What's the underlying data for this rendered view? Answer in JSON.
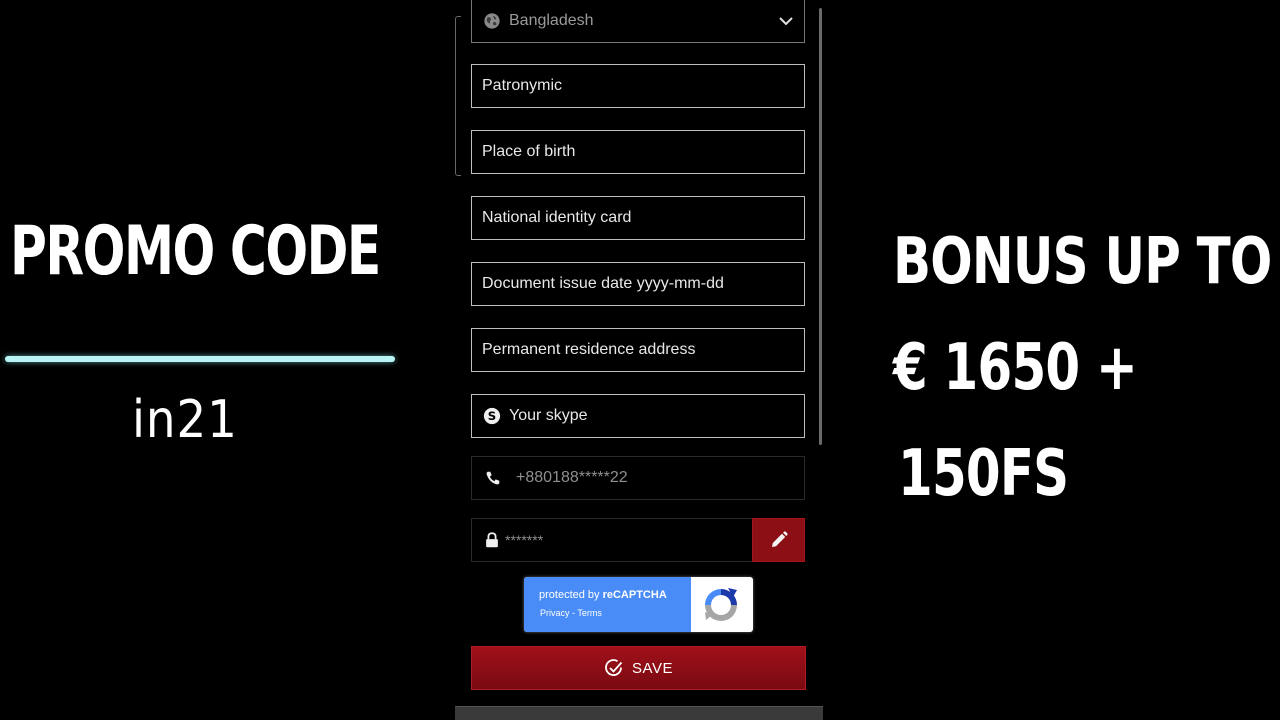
{
  "promo": {
    "title": "PROMO CODE",
    "code": "in21",
    "underline_color": "#b9f3f5"
  },
  "bonus": {
    "line1": "BONUS UP TO",
    "line2": "€ 1650 +",
    "line3": "150FS"
  },
  "form": {
    "country": {
      "value": "Bangladesh",
      "icon": "globe-icon",
      "toggle_icon": "chevron-down-icon"
    },
    "patronymic": {
      "placeholder": "Patronymic"
    },
    "place_of_birth": {
      "placeholder": "Place of birth"
    },
    "national_id": {
      "placeholder": "National identity card"
    },
    "document_issue_date": {
      "placeholder": "Document issue date yyyy-mm-dd"
    },
    "residence_address": {
      "placeholder": "Permanent residence address"
    },
    "skype": {
      "placeholder": "Your skype",
      "icon": "skype-icon"
    },
    "phone": {
      "value": "+880188*****22",
      "icon": "phone-icon"
    },
    "password": {
      "value": "*******",
      "icon": "lock-icon",
      "edit_icon": "pencil-icon"
    },
    "recaptcha": {
      "protected_by": "protected by ",
      "brand": "reCAPTCHA",
      "privacy": "Privacy",
      "separator": " - ",
      "terms": "Terms",
      "icon": "recaptcha-logo-icon"
    },
    "save": {
      "label": "SAVE",
      "icon": "check-circle-icon"
    }
  },
  "colors": {
    "background": "#000000",
    "accent_red": "#8b0f14",
    "recaptcha_blue": "#4a8cf7",
    "text_white": "#ffffff"
  }
}
